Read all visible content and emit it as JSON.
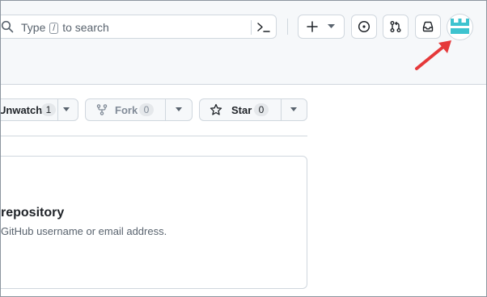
{
  "header": {
    "search_placeholder_pre": "Type",
    "search_key": "/",
    "search_placeholder_post": "to search"
  },
  "actions": {
    "watch": {
      "label": "Unwatch",
      "count": "1"
    },
    "fork": {
      "label": "Fork",
      "count": "0"
    },
    "star": {
      "label": "Star",
      "count": "0"
    }
  },
  "card": {
    "title": "repository",
    "description": "GitHub username or email address."
  },
  "colors": {
    "accent_arrow": "#e5393a",
    "avatar": "#3ec3cf"
  }
}
